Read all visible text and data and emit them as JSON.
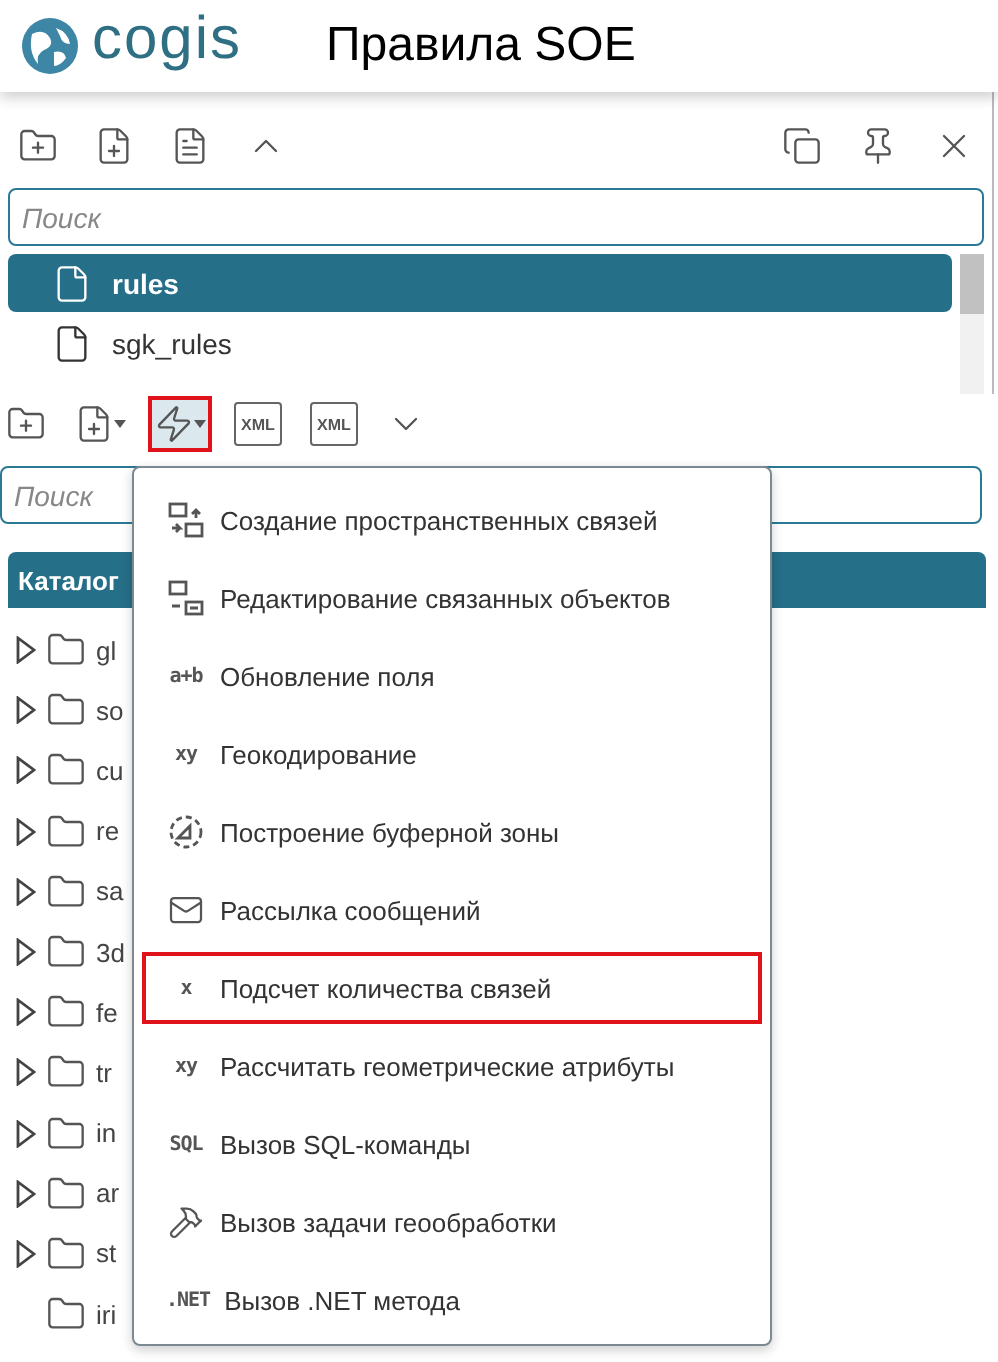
{
  "header": {
    "logo": "cogis",
    "title": "Правила SOE"
  },
  "rules_panel": {
    "toolbar": [
      {
        "kind": "folder-add"
      },
      {
        "kind": "file-add"
      },
      {
        "kind": "file-text"
      },
      {
        "kind": "collapse"
      }
    ],
    "actions": [
      {
        "kind": "copy"
      },
      {
        "kind": "pin"
      },
      {
        "kind": "close"
      }
    ],
    "search": {
      "placeholder": "Поиск"
    },
    "items": [
      {
        "name": "rules",
        "selected": true
      },
      {
        "name": "sgk_rules",
        "selected": false
      }
    ]
  },
  "catalog_toolbar": [
    {
      "kind": "folder-add",
      "selected": false
    },
    {
      "kind": "rule-add",
      "dropdown": true,
      "selected": false
    },
    {
      "kind": "action-add",
      "dropdown": true,
      "selected": true
    },
    {
      "kind": "xml-import",
      "label": "XML",
      "selected": false
    },
    {
      "kind": "xml-export",
      "label": "XML",
      "selected": false
    },
    {
      "kind": "expand",
      "selected": false
    }
  ],
  "catalog": {
    "search": {
      "placeholder": "Поиск"
    },
    "header": "Каталог",
    "tree": [
      {
        "name": "gl",
        "expandable": true
      },
      {
        "name": "so",
        "expandable": true
      },
      {
        "name": "cu",
        "expandable": true
      },
      {
        "name": "re",
        "expandable": true
      },
      {
        "name": "sa",
        "expandable": true
      },
      {
        "name": "3d",
        "expandable": true
      },
      {
        "name": "fe",
        "expandable": true
      },
      {
        "name": "tr",
        "expandable": true
      },
      {
        "name": "in",
        "expandable": true
      },
      {
        "name": "ar",
        "expandable": true
      },
      {
        "name": "st",
        "expandable": true
      },
      {
        "name": "iri",
        "expandable": false
      }
    ]
  },
  "menu": [
    {
      "label": "Создание пространственных связей",
      "kind": "link-create",
      "selected": false
    },
    {
      "label": "Редактирование связанных объектов",
      "kind": "link-edit",
      "selected": false
    },
    {
      "label": "Обновление поля",
      "kind": "field",
      "icon_text": "a+b",
      "selected": false
    },
    {
      "label": "Геокодирование",
      "kind": "geocode",
      "icon_text": "xy",
      "selected": false
    },
    {
      "label": "Построение буферной зоны",
      "kind": "buffer",
      "selected": false
    },
    {
      "label": "Рассылка сообщений",
      "kind": "mail",
      "selected": false
    },
    {
      "label": "Подсчет количества связей",
      "kind": "count",
      "icon_text": "x",
      "selected": true
    },
    {
      "label": "Рассчитать геометрические атрибуты",
      "kind": "geometry",
      "icon_text": "xy",
      "selected": false
    },
    {
      "label": "Вызов SQL-команды",
      "kind": "text",
      "icon_text": "SQL",
      "selected": false
    },
    {
      "label": "Вызов задачи геообработки",
      "kind": "hammer",
      "selected": false
    },
    {
      "label": "Вызов .NET метода",
      "kind": "text",
      "icon_text": ".NET",
      "selected": false
    }
  ]
}
